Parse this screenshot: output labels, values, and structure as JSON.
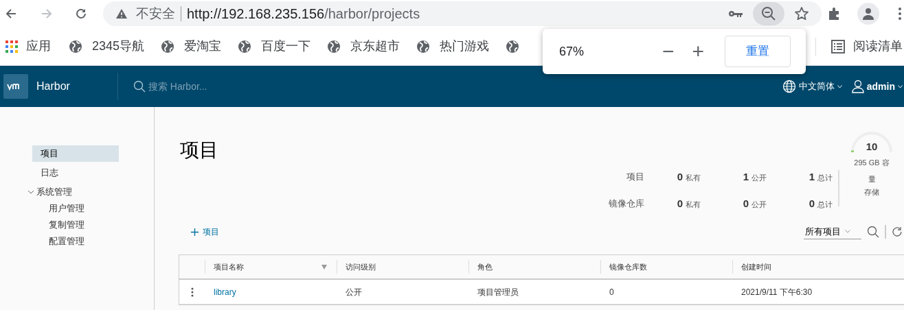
{
  "browser": {
    "security": "不安全",
    "url_host": "http://192.168.235.156",
    "url_path": "/harbor/projects",
    "bookmarks": [
      {
        "kind": "apps",
        "label": "应用"
      },
      {
        "kind": "site",
        "label": "2345导航"
      },
      {
        "kind": "site",
        "label": "爱淘宝"
      },
      {
        "kind": "site",
        "label": "百度一下"
      },
      {
        "kind": "site",
        "label": "京东超市"
      },
      {
        "kind": "site",
        "label": "热门游戏"
      },
      {
        "kind": "hidden"
      }
    ],
    "reading_list": "阅读清单",
    "zoom_popup": {
      "percent": "67%",
      "minus": "−",
      "plus": "+",
      "reset": "重置"
    }
  },
  "header": {
    "brand": "Harbor",
    "search_placeholder": "搜索 Harbor...",
    "language": "中文简体",
    "user": "admin"
  },
  "sidebar": {
    "items": [
      {
        "label": "项目",
        "selected": true
      },
      {
        "label": "日志",
        "selected": false
      },
      {
        "label": "系统管理",
        "selected": false,
        "expanded": true,
        "children": [
          {
            "label": "用户管理",
            "selected": false
          },
          {
            "label": "复制管理",
            "selected": false
          },
          {
            "label": "配置管理",
            "selected": false
          }
        ]
      }
    ]
  },
  "page_title": "项目",
  "stats": [
    {
      "label": "项目",
      "cells": [
        {
          "value": "0",
          "label": "私有"
        },
        {
          "value": "1",
          "label": "公开"
        },
        {
          "value": "1",
          "label": "总计"
        }
      ]
    },
    {
      "label": "镜像仓库",
      "cells": [
        {
          "value": "0",
          "label": "私有"
        },
        {
          "value": "0",
          "label": "公开"
        },
        {
          "value": "0",
          "label": "总计"
        }
      ]
    }
  ],
  "storage": {
    "value": "10",
    "capacity": "295 GB 容量",
    "label": "存储",
    "level": 0.03
  },
  "toolbar": {
    "add": "项目",
    "filter": "所有项目"
  },
  "table": {
    "columns": [
      {
        "label": "项目名称",
        "filter": true
      },
      {
        "label": "访问级别",
        "filter": false
      },
      {
        "label": "角色",
        "filter": false
      },
      {
        "label": "镜像仓库数",
        "filter": false
      },
      {
        "label": "创建时间",
        "filter": false
      }
    ],
    "rows": [
      {
        "cells": [
          {
            "kind": "link",
            "text": "library"
          },
          {
            "kind": "text",
            "text": "公开"
          },
          {
            "kind": "text",
            "text": "项目管理员"
          },
          {
            "kind": "text",
            "text": "0"
          },
          {
            "kind": "text",
            "text": "2021/9/11 下午6:30"
          }
        ]
      }
    ]
  }
}
